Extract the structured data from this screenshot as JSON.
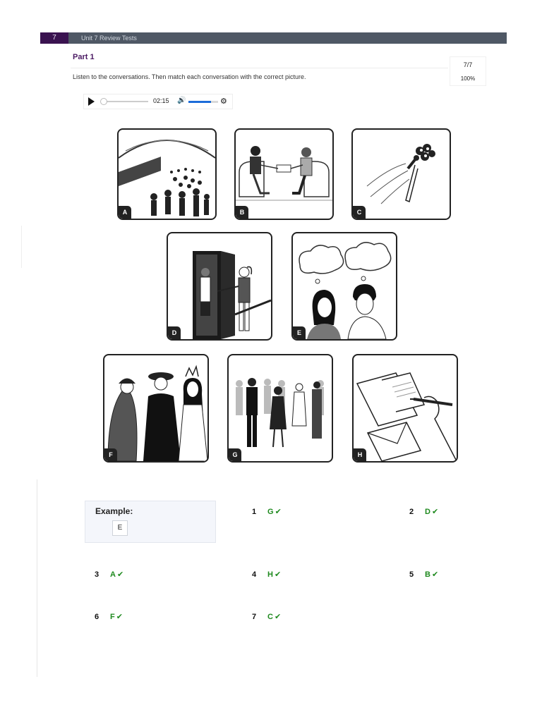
{
  "header": {
    "unit_number": "7",
    "unit_title": "Unit 7 Review Tests"
  },
  "part": {
    "title": "Part 1",
    "instructions": "Listen to the conversations. Then match each conversation with the correct picture.",
    "score": "7/7",
    "percent": "100%"
  },
  "player": {
    "time": "02:15",
    "progress": 0.02,
    "volume": 0.75
  },
  "pictures": [
    {
      "label": "A",
      "icon": "crowded-subway-platform-icon"
    },
    {
      "label": "B",
      "icon": "people-exchanging-gift-icon"
    },
    {
      "label": "C",
      "icon": "tossed-bouquet-icon"
    },
    {
      "label": "D",
      "icon": "person-at-door-icon"
    },
    {
      "label": "E",
      "icon": "couple-thinking-icon"
    },
    {
      "label": "F",
      "icon": "costume-party-icon"
    },
    {
      "label": "G",
      "icon": "party-crowd-icon"
    },
    {
      "label": "H",
      "icon": "writing-card-icon"
    }
  ],
  "example": {
    "title": "Example:",
    "answer": "E"
  },
  "answers": [
    {
      "number": "1",
      "letter": "G",
      "correct": true
    },
    {
      "number": "2",
      "letter": "D",
      "correct": true
    },
    {
      "number": "3",
      "letter": "A",
      "correct": true
    },
    {
      "number": "4",
      "letter": "H",
      "correct": true
    },
    {
      "number": "5",
      "letter": "B",
      "correct": true
    },
    {
      "number": "6",
      "letter": "F",
      "correct": true
    },
    {
      "number": "7",
      "letter": "C",
      "correct": true
    }
  ],
  "check_mark": "✔",
  "colors": {
    "purple": "#4b1a63",
    "correct_green": "#1f8a1f",
    "volume_blue": "#1c6cd9",
    "header_gray": "#4f5865"
  }
}
